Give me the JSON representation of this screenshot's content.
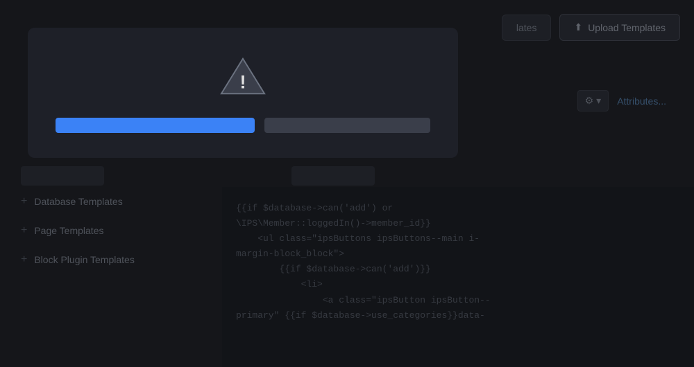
{
  "toolbar": {
    "templates_label": "lates",
    "upload_icon": "⬆",
    "upload_label": "Upload Templates"
  },
  "sub_toolbar": {
    "gear_icon": "⚙",
    "chevron_icon": "▾",
    "attributes_label": "Attributes..."
  },
  "sidebar": {
    "items": [
      {
        "label": "Database Templates"
      },
      {
        "label": "Page Templates"
      },
      {
        "label": "Block Plugin Templates"
      }
    ],
    "plus_icon": "+"
  },
  "code": {
    "lines": [
      "{{if $database->can('add') or",
      "\\IPS\\Member::loggedIn()->member_id}}",
      "    <ul class=\"ipsButtons ipsButtons--main i-",
      "margin-block_block\">",
      "        {{if $database->can('add')}}",
      "            <li>",
      "                <a class=\"ipsButton ipsButton--",
      "primary\" {{if $database->use_categories}}data-"
    ]
  },
  "modal": {
    "warning_icon": "⚠",
    "progress_active_width": "55%",
    "progress_inactive_width": "45%"
  }
}
